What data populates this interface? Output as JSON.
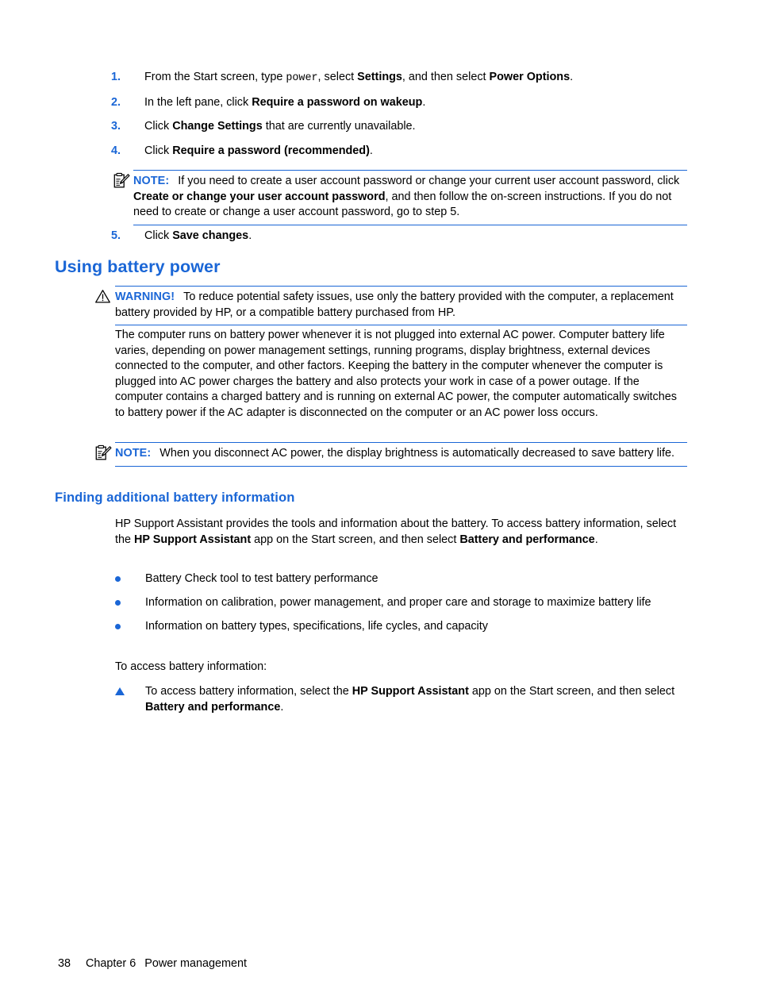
{
  "document": {
    "type": "hp-user-guide-page",
    "accent_blue": "#1a66d6",
    "text_black": "#000000",
    "background": "#ffffff"
  },
  "steps": [
    {
      "number": "1.",
      "parts": [
        {
          "text": "From the Start screen, type ",
          "style": "normal"
        },
        {
          "text": "power",
          "style": "mono"
        },
        {
          "text": ", select ",
          "style": "normal"
        },
        {
          "text": "Settings",
          "style": "bold"
        },
        {
          "text": ", and then select ",
          "style": "normal"
        },
        {
          "text": "Power Options",
          "style": "bold"
        },
        {
          "text": ".",
          "style": "normal"
        }
      ]
    },
    {
      "number": "2.",
      "parts": [
        {
          "text": "In the left pane, click ",
          "style": "normal"
        },
        {
          "text": "Require a password on wakeup",
          "style": "bold"
        },
        {
          "text": ".",
          "style": "normal"
        }
      ]
    },
    {
      "number": "3.",
      "parts": [
        {
          "text": "Click ",
          "style": "normal"
        },
        {
          "text": "Change Settings",
          "style": "bold"
        },
        {
          "text": " that are currently unavailable",
          "style": "normal"
        },
        {
          "text": ".",
          "style": "normal"
        }
      ]
    },
    {
      "number": "4.",
      "parts": [
        {
          "text": "Click ",
          "style": "normal"
        },
        {
          "text": "Require a password (recommended)",
          "style": "bold"
        },
        {
          "text": ".",
          "style": "normal"
        }
      ]
    }
  ],
  "note_1": {
    "icon": "note-clipboard-pencil-icon",
    "label": "NOTE:",
    "parts": [
      {
        "text": "If you need to create a user account password or change your current user account password, click ",
        "style": "normal"
      },
      {
        "text": "Create or change your user account password",
        "style": "bold"
      },
      {
        "text": ", and then follow the on-screen instructions. If you do not need to create or change a user account password, go to step 5.",
        "style": "normal"
      }
    ]
  },
  "step_5": {
    "number": "5.",
    "parts": [
      {
        "text": "Click ",
        "style": "normal"
      },
      {
        "text": "Save changes",
        "style": "bold"
      },
      {
        "text": ".",
        "style": "normal"
      }
    ]
  },
  "heading_using_battery_power": "Using battery power",
  "warning": {
    "icon": "warning-triangle-icon",
    "label": "WARNING!",
    "parts": [
      {
        "text": "To reduce potential safety issues, use only the battery provided with the computer, a replacement battery provided by HP, or a compatible battery purchased from HP.",
        "style": "normal"
      }
    ]
  },
  "paragraph_battery_runs": "The computer runs on battery power whenever it is not plugged into external AC power. Computer battery life varies, depending on power management settings, running programs, display brightness, external devices connected to the computer, and other factors. Keeping the battery in the computer whenever the computer is plugged into AC power charges the battery and also protects your work in case of a power outage. If the computer contains a charged battery and is running on external AC power, the computer automatically switches to battery power if the AC adapter is disconnected on the computer or an AC power loss occurs.",
  "note_2": {
    "icon": "note-clipboard-pencil-icon",
    "label": "NOTE:",
    "parts": [
      {
        "text": "When you disconnect AC power, the display brightness is automatically decreased to save battery life.",
        "style": "normal"
      }
    ]
  },
  "heading_finding_additional": "Finding additional battery information",
  "paragraph_hp_support": {
    "parts": [
      {
        "text": "HP Support Assistant provides the tools and information about the battery. To access battery information, select the ",
        "style": "normal"
      },
      {
        "text": "HP Support Assistant",
        "style": "bold"
      },
      {
        "text": " app on the Start screen, and then select ",
        "style": "normal"
      },
      {
        "text": "Battery and performance",
        "style": "bold"
      },
      {
        "text": ".",
        "style": "normal"
      }
    ]
  },
  "bullets": [
    {
      "marker": "dot",
      "parts": [
        {
          "text": "Battery Check tool to test battery performance",
          "style": "normal"
        }
      ]
    },
    {
      "marker": "dot",
      "parts": [
        {
          "text": "Information on calibration, power management, and proper care and storage to maximize battery life",
          "style": "normal"
        }
      ]
    },
    {
      "marker": "dot",
      "parts": [
        {
          "text": "Information on battery types, specifications, life cycles, and capacity",
          "style": "normal"
        }
      ]
    }
  ],
  "paragraph_to_access": "To access battery information:",
  "triangle_item": {
    "marker": "triangle",
    "parts": [
      {
        "text": "To access battery information, select the ",
        "style": "normal"
      },
      {
        "text": "HP Support Assistant",
        "style": "bold"
      },
      {
        "text": " app on the Start screen, and then select ",
        "style": "normal"
      },
      {
        "text": "Battery and performance",
        "style": "bold"
      },
      {
        "text": ".",
        "style": "normal"
      }
    ]
  },
  "footer": {
    "page_number": "38",
    "chapter": "Chapter 6",
    "chapter_title": "Power management"
  }
}
